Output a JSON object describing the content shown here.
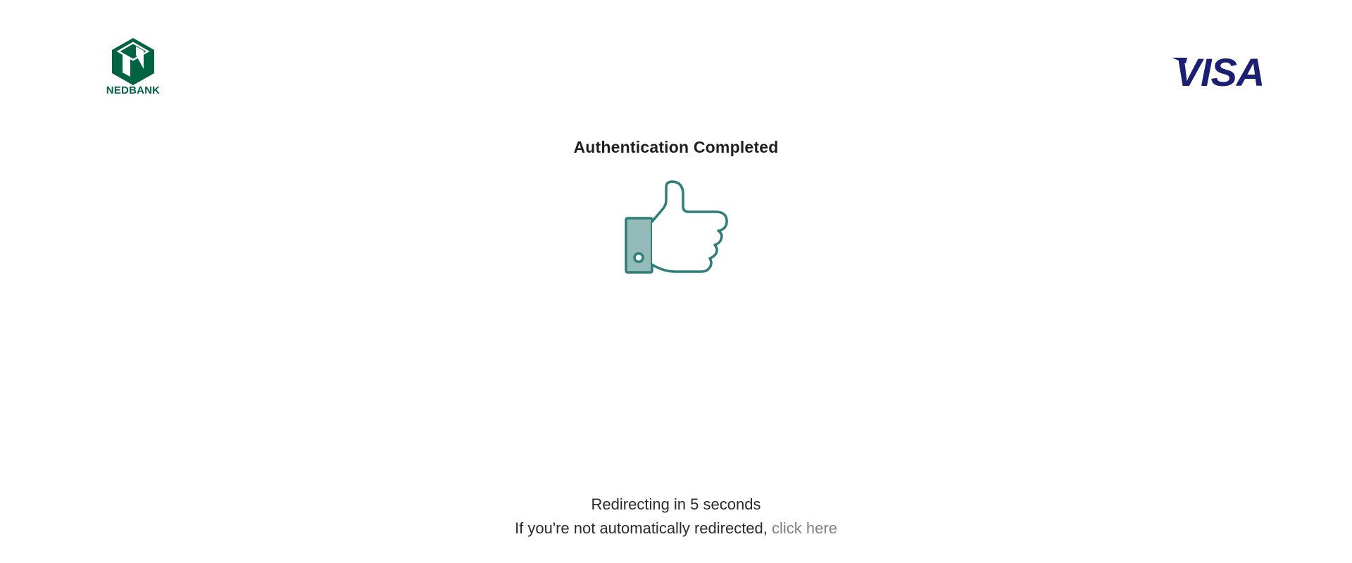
{
  "header": {
    "bank_logo": {
      "icon": "nedbank-n-icon",
      "wordmark": "NEDBANK",
      "color": "#006341"
    },
    "card_logo": {
      "icon": "visa-icon",
      "wordmark": "VISA",
      "color": "#1a1f71"
    }
  },
  "main": {
    "title": "Authentication Completed",
    "status_icon": "thumbs-up-icon",
    "icon_color": "#2e7d78",
    "icon_fill": "#94bbb7"
  },
  "footer": {
    "redirect_text": "Redirecting in 5 seconds",
    "manual_prefix": "If you're not automatically redirected,",
    "manual_link": "click here",
    "link_color": "#7a8188"
  }
}
